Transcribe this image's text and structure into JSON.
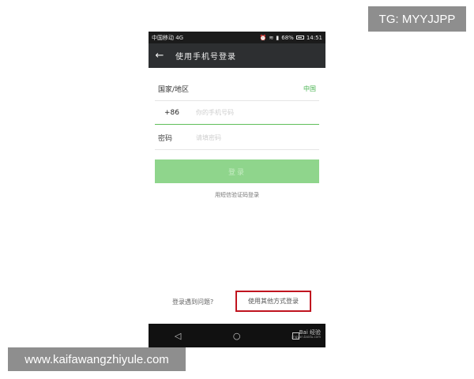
{
  "status_bar": {
    "carrier": "中国移动 4G",
    "battery": "68%",
    "time": "14:51"
  },
  "app_bar": {
    "back_icon": "←",
    "title": "使用手机号登录"
  },
  "form": {
    "region_label": "国家/地区",
    "region_value": "中国",
    "country_code": "+86",
    "phone_placeholder": "你的手机号码",
    "password_label": "密码",
    "password_placeholder": "请填密码"
  },
  "buttons": {
    "login_label": "登录",
    "sms_login_label": "用短信验证码登录"
  },
  "footer": {
    "problem_text": "登录遇到问题?",
    "other_methods_label": "使用其他方式登录"
  },
  "nav_bar": {
    "back_glyph": "◁",
    "home_glyph": "○",
    "watermark": "Bai 经验",
    "watermark_sub": "jingyan.baidu.com"
  },
  "overlays": {
    "tg_text": "TG: MYYJJPP",
    "site_text": "www.kaifawangzhiyule.com"
  },
  "colors": {
    "accent_green": "#5fbf5a",
    "button_green": "#8fd58c",
    "highlight_red": "#c0141f",
    "app_bar": "#2d2f31"
  }
}
